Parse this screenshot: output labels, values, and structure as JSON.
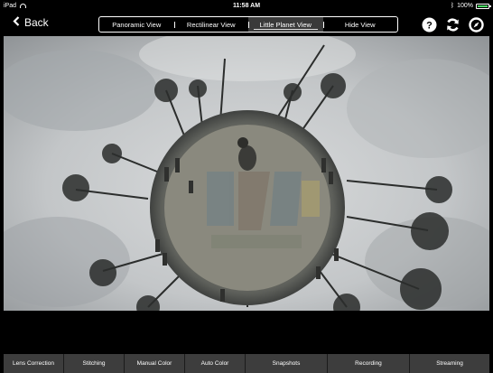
{
  "status_bar": {
    "device": "iPad",
    "time": "11:58 AM",
    "battery": "100%",
    "battery_level": 1.0
  },
  "nav": {
    "back_label": "Back",
    "view_modes": [
      {
        "label": "Panoramic View"
      },
      {
        "label": "Rectilinear View"
      },
      {
        "label": "Little Planet View",
        "selected": true
      },
      {
        "label": "Hide View"
      }
    ],
    "icons": [
      "help-icon",
      "refresh-icon",
      "compass-icon"
    ]
  },
  "toolbar": {
    "items": [
      {
        "label": "Lens Correction"
      },
      {
        "label": "Stitching"
      },
      {
        "label": "Manual Color"
      },
      {
        "label": "Auto Color"
      },
      {
        "label": "Snapshots"
      },
      {
        "label": "Recording"
      },
      {
        "label": "Streaming"
      }
    ]
  },
  "colors": {
    "toolbar_bg": "#3d3d3d",
    "active_segment_bg": "#3a3a3a",
    "battery": "#4cd964"
  }
}
